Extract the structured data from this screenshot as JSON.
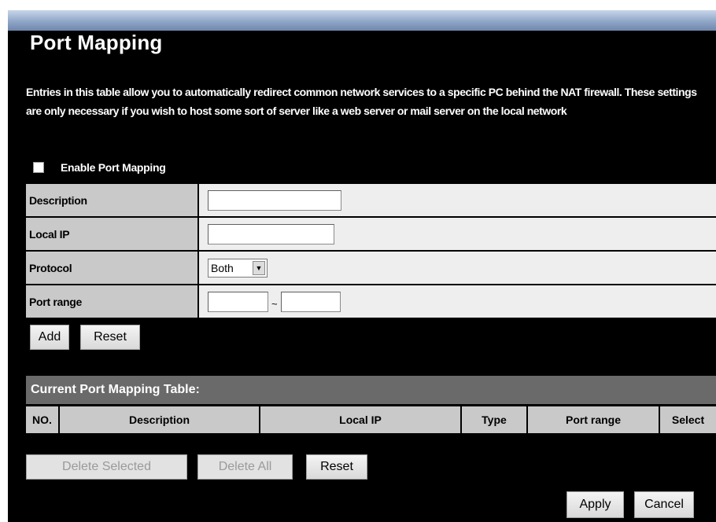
{
  "page": {
    "title": "Port Mapping",
    "description": "Entries in this table allow you to automatically redirect common network services to a specific PC behind the NAT firewall. These settings are only necessary if you wish to host some sort of server like a web server or mail server on the local network"
  },
  "enable": {
    "label": "Enable Port Mapping",
    "checked": false
  },
  "form": {
    "description_label": "Description",
    "description_value": "",
    "local_ip_label": "Local IP",
    "local_ip_value": "",
    "protocol_label": "Protocol",
    "protocol_value": "Both",
    "port_range_label": "Port range",
    "port_from": "",
    "port_separator": "~",
    "port_to": ""
  },
  "form_buttons": {
    "add": "Add",
    "reset": "Reset"
  },
  "table": {
    "title": "Current Port Mapping Table:",
    "columns": [
      "NO.",
      "Description",
      "Local IP",
      "Type",
      "Port range",
      "Select"
    ]
  },
  "table_buttons": {
    "delete_selected": "Delete Selected",
    "delete_all": "Delete All",
    "reset": "Reset"
  },
  "footer_buttons": {
    "apply": "Apply",
    "cancel": "Cancel"
  },
  "colors": {
    "background": "#000000",
    "label_cell": "#c9c9c9",
    "value_cell": "#eeeeee",
    "table_header": "#6a6a6a"
  }
}
